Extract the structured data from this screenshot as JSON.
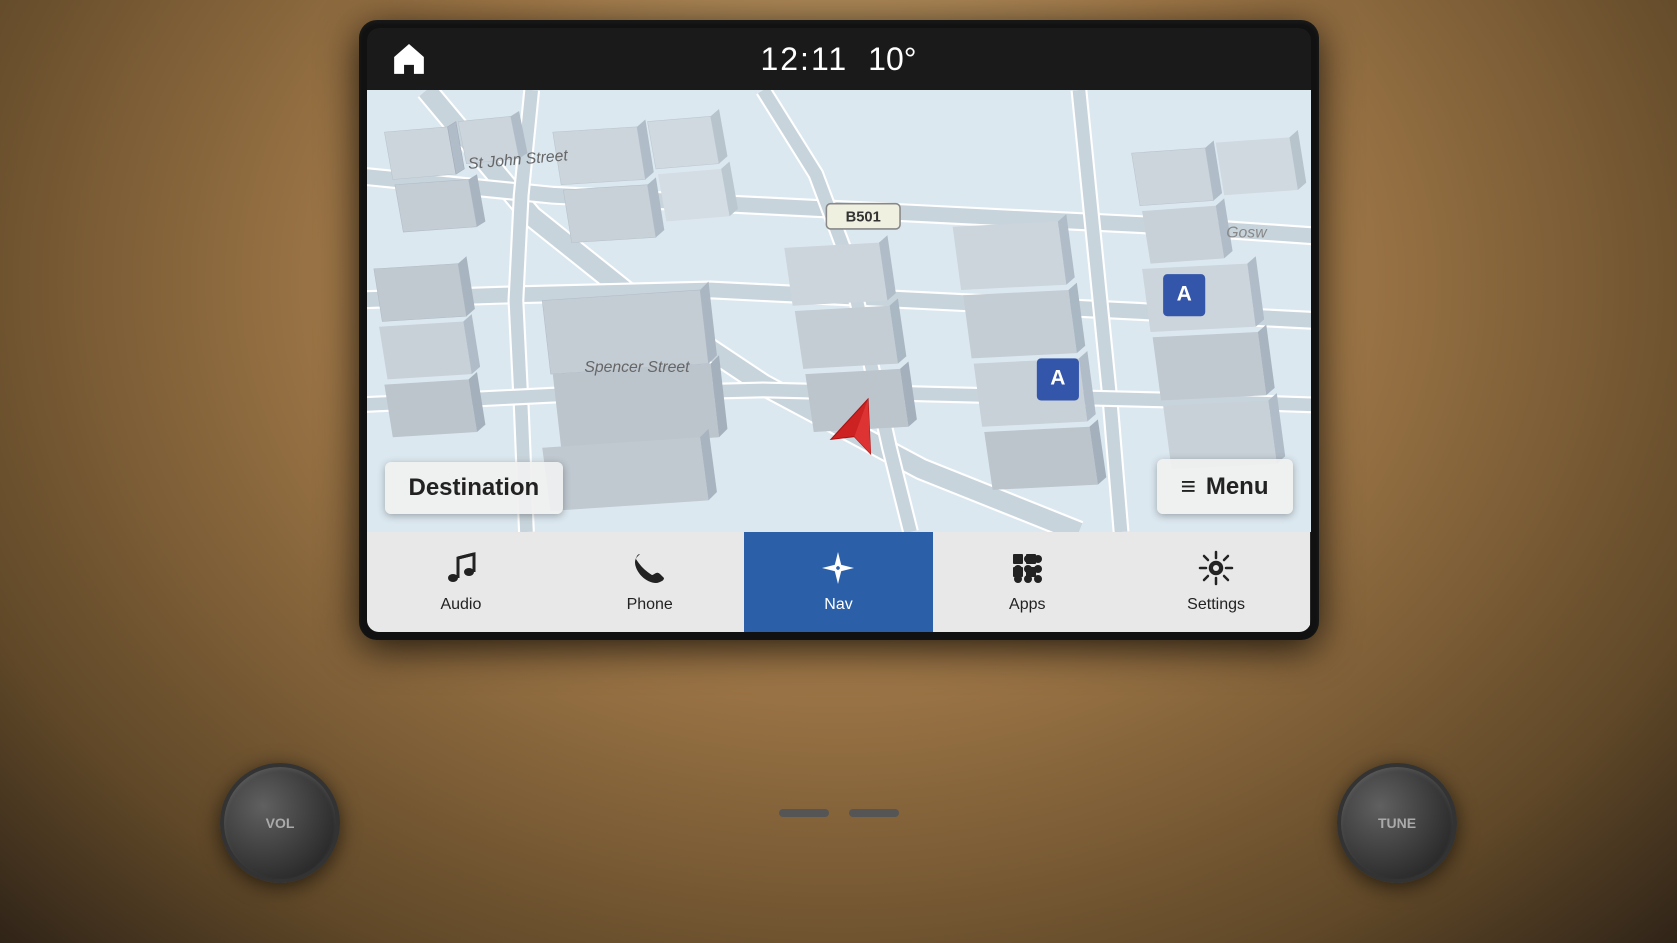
{
  "screen": {
    "statusBar": {
      "time": "12:11",
      "temperature": "10°",
      "homeIcon": "home-icon"
    },
    "map": {
      "streetLabels": [
        "St John Street",
        "Spencer Street",
        "B501",
        "Gosw"
      ],
      "destinationBtn": "Destination",
      "menuBtn": "Menu",
      "menuIcon": "≡"
    },
    "navBar": {
      "items": [
        {
          "id": "audio",
          "label": "Audio",
          "icon": "♪",
          "active": false
        },
        {
          "id": "phone",
          "label": "Phone",
          "icon": "✆",
          "active": false
        },
        {
          "id": "nav",
          "label": "Nav",
          "icon": "✦",
          "active": true
        },
        {
          "id": "apps",
          "label": "Apps",
          "icon": "⠿",
          "active": false
        },
        {
          "id": "settings",
          "label": "Settings",
          "icon": "⚙",
          "active": false
        }
      ]
    }
  },
  "knobs": {
    "left": "VOL",
    "right": "TUNE"
  }
}
